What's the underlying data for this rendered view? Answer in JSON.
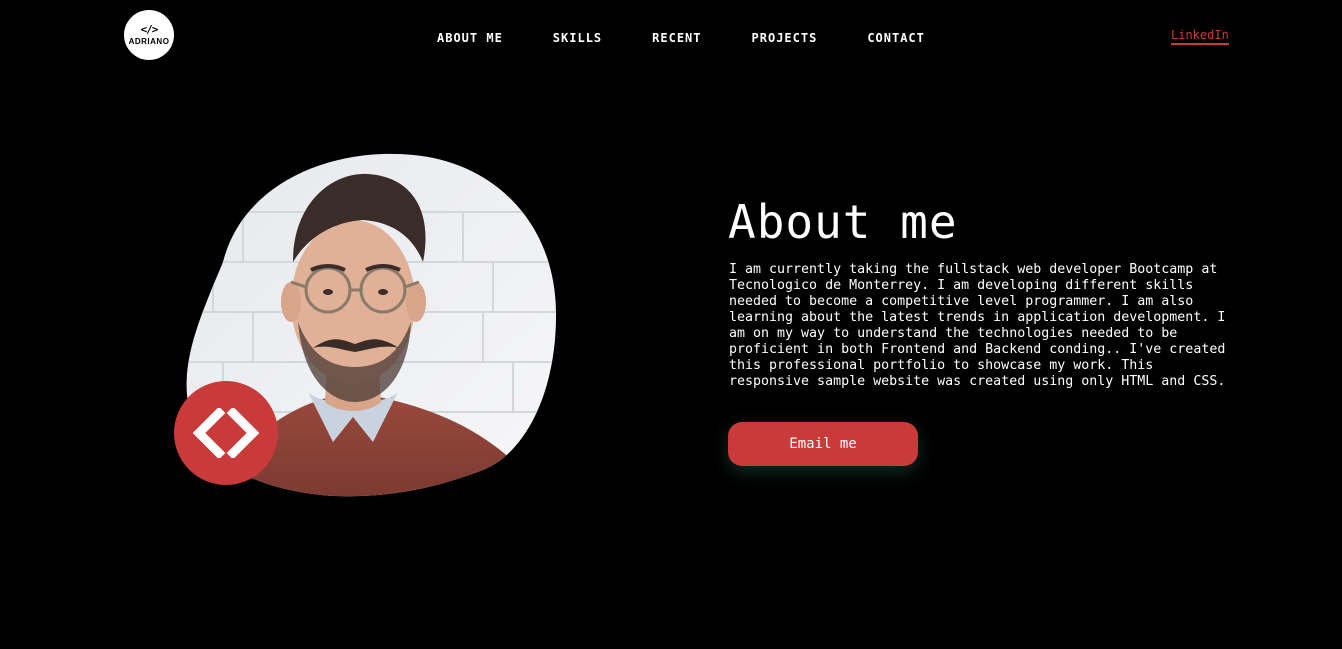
{
  "header": {
    "logo": {
      "glyph": "</>",
      "text": "ADRIANO"
    },
    "nav": [
      {
        "label": "ABOUT ME"
      },
      {
        "label": "SKILLS"
      },
      {
        "label": "RECENT"
      },
      {
        "label": "PROJECTS"
      },
      {
        "label": "CONTACT"
      }
    ],
    "linkedin_label": "LinkedIn"
  },
  "hero": {
    "photo_icon": "portrait-photo",
    "badge_icon": "code-brackets-icon"
  },
  "about": {
    "title": "About me",
    "body": "I am currently taking the fullstack web developer Bootcamp at Tecnologico de Monterrey. I am developing different skills needed to become a competitive level programmer. I am also learning about the latest trends in application development. I am on my way to understand the technologies needed to be proficient in both Frontend and Backend conding.. I've created this professional portfolio to showcase my work. This responsive sample website was created using only HTML and CSS.",
    "email_button": "Email me"
  },
  "colors": {
    "background": "#000000",
    "accent": "#c93a3a",
    "text": "#ffffff"
  }
}
